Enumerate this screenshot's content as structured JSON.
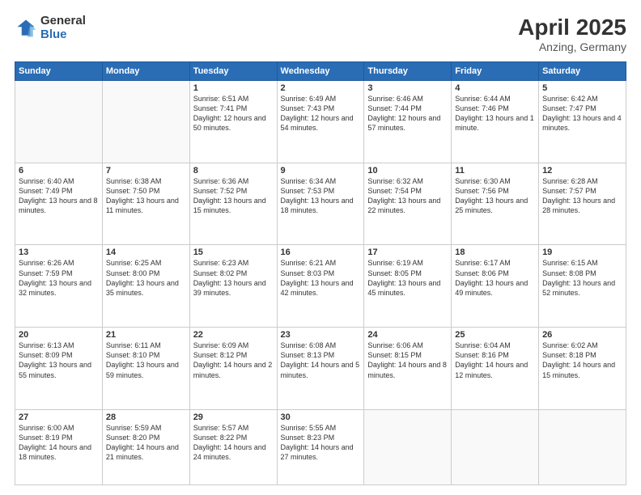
{
  "header": {
    "logo_general": "General",
    "logo_blue": "Blue",
    "title": "April 2025",
    "location": "Anzing, Germany"
  },
  "days_of_week": [
    "Sunday",
    "Monday",
    "Tuesday",
    "Wednesday",
    "Thursday",
    "Friday",
    "Saturday"
  ],
  "weeks": [
    [
      {
        "day": "",
        "info": ""
      },
      {
        "day": "",
        "info": ""
      },
      {
        "day": "1",
        "info": "Sunrise: 6:51 AM\nSunset: 7:41 PM\nDaylight: 12 hours and 50 minutes."
      },
      {
        "day": "2",
        "info": "Sunrise: 6:49 AM\nSunset: 7:43 PM\nDaylight: 12 hours and 54 minutes."
      },
      {
        "day": "3",
        "info": "Sunrise: 6:46 AM\nSunset: 7:44 PM\nDaylight: 12 hours and 57 minutes."
      },
      {
        "day": "4",
        "info": "Sunrise: 6:44 AM\nSunset: 7:46 PM\nDaylight: 13 hours and 1 minute."
      },
      {
        "day": "5",
        "info": "Sunrise: 6:42 AM\nSunset: 7:47 PM\nDaylight: 13 hours and 4 minutes."
      }
    ],
    [
      {
        "day": "6",
        "info": "Sunrise: 6:40 AM\nSunset: 7:49 PM\nDaylight: 13 hours and 8 minutes."
      },
      {
        "day": "7",
        "info": "Sunrise: 6:38 AM\nSunset: 7:50 PM\nDaylight: 13 hours and 11 minutes."
      },
      {
        "day": "8",
        "info": "Sunrise: 6:36 AM\nSunset: 7:52 PM\nDaylight: 13 hours and 15 minutes."
      },
      {
        "day": "9",
        "info": "Sunrise: 6:34 AM\nSunset: 7:53 PM\nDaylight: 13 hours and 18 minutes."
      },
      {
        "day": "10",
        "info": "Sunrise: 6:32 AM\nSunset: 7:54 PM\nDaylight: 13 hours and 22 minutes."
      },
      {
        "day": "11",
        "info": "Sunrise: 6:30 AM\nSunset: 7:56 PM\nDaylight: 13 hours and 25 minutes."
      },
      {
        "day": "12",
        "info": "Sunrise: 6:28 AM\nSunset: 7:57 PM\nDaylight: 13 hours and 28 minutes."
      }
    ],
    [
      {
        "day": "13",
        "info": "Sunrise: 6:26 AM\nSunset: 7:59 PM\nDaylight: 13 hours and 32 minutes."
      },
      {
        "day": "14",
        "info": "Sunrise: 6:25 AM\nSunset: 8:00 PM\nDaylight: 13 hours and 35 minutes."
      },
      {
        "day": "15",
        "info": "Sunrise: 6:23 AM\nSunset: 8:02 PM\nDaylight: 13 hours and 39 minutes."
      },
      {
        "day": "16",
        "info": "Sunrise: 6:21 AM\nSunset: 8:03 PM\nDaylight: 13 hours and 42 minutes."
      },
      {
        "day": "17",
        "info": "Sunrise: 6:19 AM\nSunset: 8:05 PM\nDaylight: 13 hours and 45 minutes."
      },
      {
        "day": "18",
        "info": "Sunrise: 6:17 AM\nSunset: 8:06 PM\nDaylight: 13 hours and 49 minutes."
      },
      {
        "day": "19",
        "info": "Sunrise: 6:15 AM\nSunset: 8:08 PM\nDaylight: 13 hours and 52 minutes."
      }
    ],
    [
      {
        "day": "20",
        "info": "Sunrise: 6:13 AM\nSunset: 8:09 PM\nDaylight: 13 hours and 55 minutes."
      },
      {
        "day": "21",
        "info": "Sunrise: 6:11 AM\nSunset: 8:10 PM\nDaylight: 13 hours and 59 minutes."
      },
      {
        "day": "22",
        "info": "Sunrise: 6:09 AM\nSunset: 8:12 PM\nDaylight: 14 hours and 2 minutes."
      },
      {
        "day": "23",
        "info": "Sunrise: 6:08 AM\nSunset: 8:13 PM\nDaylight: 14 hours and 5 minutes."
      },
      {
        "day": "24",
        "info": "Sunrise: 6:06 AM\nSunset: 8:15 PM\nDaylight: 14 hours and 8 minutes."
      },
      {
        "day": "25",
        "info": "Sunrise: 6:04 AM\nSunset: 8:16 PM\nDaylight: 14 hours and 12 minutes."
      },
      {
        "day": "26",
        "info": "Sunrise: 6:02 AM\nSunset: 8:18 PM\nDaylight: 14 hours and 15 minutes."
      }
    ],
    [
      {
        "day": "27",
        "info": "Sunrise: 6:00 AM\nSunset: 8:19 PM\nDaylight: 14 hours and 18 minutes."
      },
      {
        "day": "28",
        "info": "Sunrise: 5:59 AM\nSunset: 8:20 PM\nDaylight: 14 hours and 21 minutes."
      },
      {
        "day": "29",
        "info": "Sunrise: 5:57 AM\nSunset: 8:22 PM\nDaylight: 14 hours and 24 minutes."
      },
      {
        "day": "30",
        "info": "Sunrise: 5:55 AM\nSunset: 8:23 PM\nDaylight: 14 hours and 27 minutes."
      },
      {
        "day": "",
        "info": ""
      },
      {
        "day": "",
        "info": ""
      },
      {
        "day": "",
        "info": ""
      }
    ]
  ]
}
